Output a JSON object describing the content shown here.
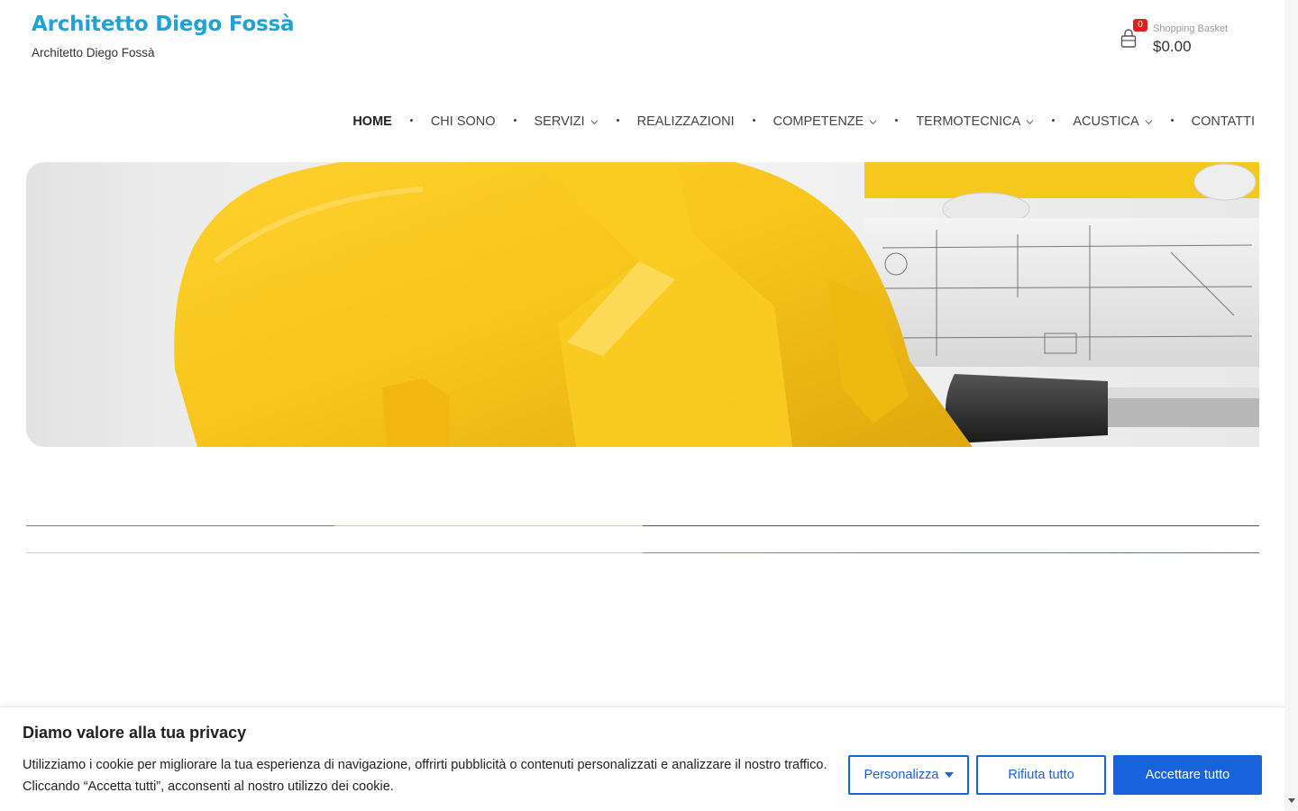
{
  "header": {
    "site_title": "Architetto Diego Fossà",
    "tagline": "Architetto Diego Fossà",
    "cart": {
      "badge_count": "0",
      "label": "Shopping Basket",
      "total": "$0.00"
    }
  },
  "nav": {
    "items": [
      {
        "label": "HOME"
      },
      {
        "label": "CHI SONO"
      },
      {
        "label": "SERVIZI"
      },
      {
        "label": "REALIZZAZIONI"
      },
      {
        "label": "COMPETENZE"
      },
      {
        "label": "TERMOTECNICA"
      },
      {
        "label": "ACUSTICA"
      },
      {
        "label": "CONTATTI"
      }
    ]
  },
  "hero": {
    "image": "yellow-hardhat-blueprints-hammer"
  },
  "cookie_banner": {
    "title": "Diamo valore alla tua privacy",
    "text": "Utilizziamo i cookie per migliorare la tua esperienza di navigazione, offrirti pubblicità o contenuti personalizzati e analizzare il nostro traffico. Cliccando “Accetta tutti”, acconsenti al nostro utilizzo dei cookie.",
    "customize_label": "Personalizza",
    "reject_label": "Rifiuta tutto",
    "accept_label": "Accettare tutto"
  },
  "colors": {
    "brand": "#1fa2d7",
    "cookie_accent": "#1863dc",
    "badge": "#e02020",
    "helmet_yellow": "#f7c51c"
  }
}
